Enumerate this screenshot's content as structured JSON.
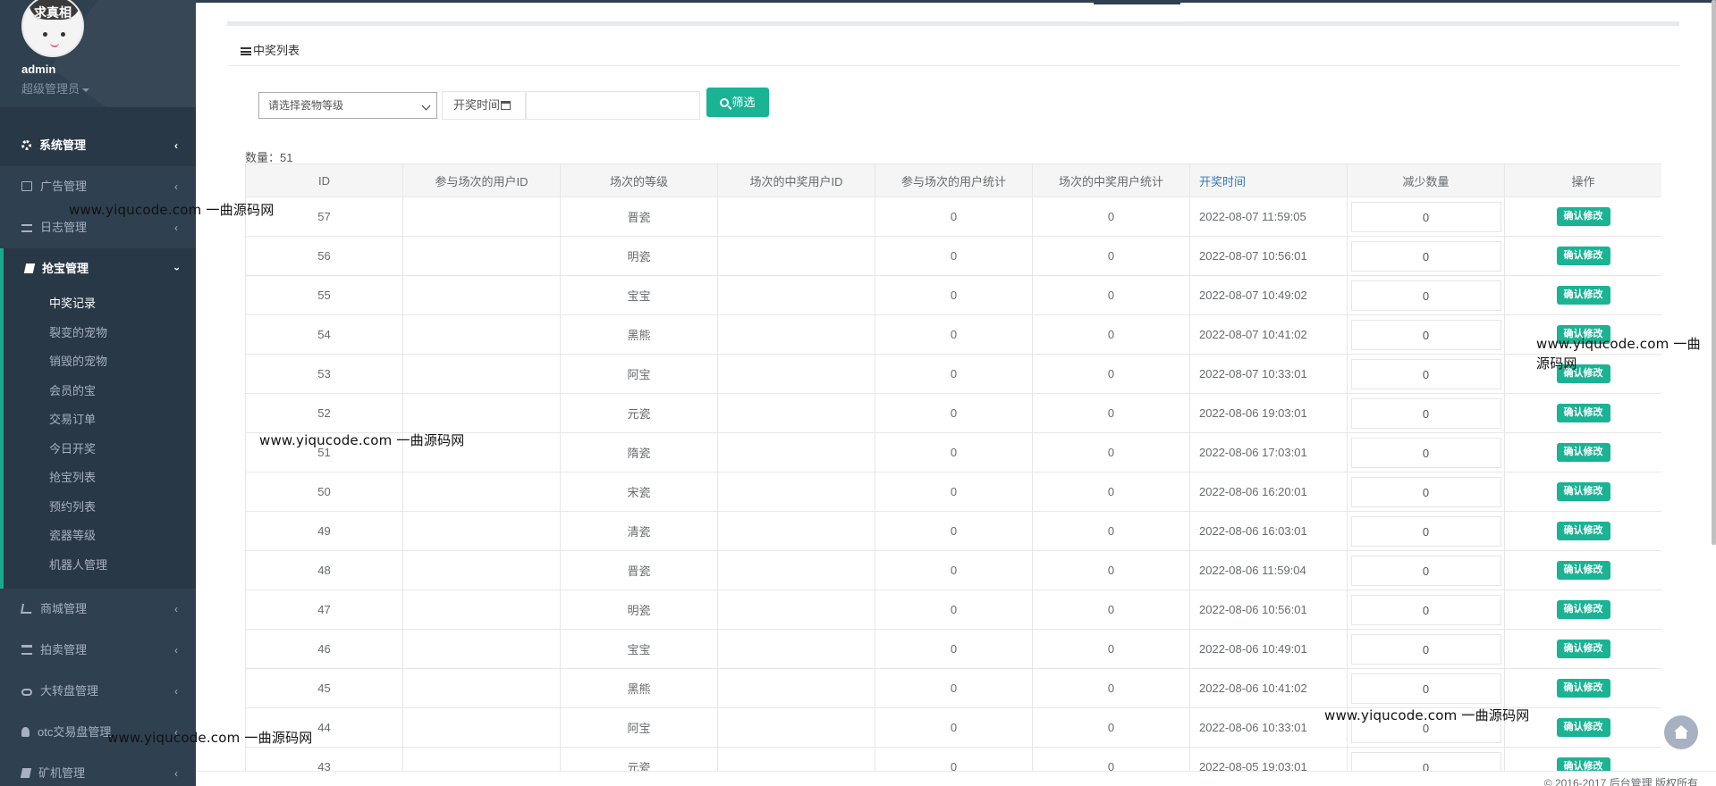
{
  "profile": {
    "avatar_text": "求真相",
    "username": "admin",
    "role": "超级管理员"
  },
  "menu": {
    "items_top": [
      {
        "label": "系统管理",
        "icon": "gear-icon"
      },
      {
        "label": "广告管理",
        "icon": "picture-icon"
      },
      {
        "label": "日志管理",
        "icon": "list-icon"
      }
    ],
    "active_group": {
      "label": "抢宝管理",
      "icon": "book-icon",
      "children": [
        "中奖记录",
        "裂变的宠物",
        "销毁的宠物",
        "会员的宝",
        "交易订单",
        "今日开奖",
        "抢宝列表",
        "预约列表",
        "瓷器等级",
        "机器人管理"
      ]
    },
    "items_bottom": [
      {
        "label": "商城管理",
        "icon": "cart-icon"
      },
      {
        "label": "拍卖管理",
        "icon": "bank-icon"
      },
      {
        "label": "大转盘管理",
        "icon": "gamepad-icon"
      },
      {
        "label": "otc交易盘管理",
        "icon": "user-icon"
      },
      {
        "label": "矿机管理",
        "icon": "book-icon"
      }
    ]
  },
  "panel": {
    "title": "中奖列表"
  },
  "filter": {
    "select_placeholder": "请选择瓷物等级",
    "date_label": "开奖时间",
    "date_value": "",
    "button_label": "筛选"
  },
  "count_text": "数量：51",
  "table": {
    "headers": [
      "ID",
      "参与场次的用户ID",
      "场次的等级",
      "场次的中奖用户ID",
      "参与场次的用户统计",
      "场次的中奖用户统计",
      "开奖时间",
      "减少数量",
      "操作"
    ],
    "action_label": "确认修改",
    "rows": [
      {
        "id": "57",
        "users": "",
        "level": "晋瓷",
        "winner": "",
        "user_count": "0",
        "win_count": "0",
        "time": "2022-08-07 11:59:05",
        "reduce": "0"
      },
      {
        "id": "56",
        "users": "",
        "level": "明瓷",
        "winner": "",
        "user_count": "0",
        "win_count": "0",
        "time": "2022-08-07 10:56:01",
        "reduce": "0"
      },
      {
        "id": "55",
        "users": "",
        "level": "宝宝",
        "winner": "",
        "user_count": "0",
        "win_count": "0",
        "time": "2022-08-07 10:49:02",
        "reduce": "0"
      },
      {
        "id": "54",
        "users": "",
        "level": "黑熊",
        "winner": "",
        "user_count": "0",
        "win_count": "0",
        "time": "2022-08-07 10:41:02",
        "reduce": "0"
      },
      {
        "id": "53",
        "users": "",
        "level": "阿宝",
        "winner": "",
        "user_count": "0",
        "win_count": "0",
        "time": "2022-08-07 10:33:01",
        "reduce": "0"
      },
      {
        "id": "52",
        "users": "",
        "level": "元瓷",
        "winner": "",
        "user_count": "0",
        "win_count": "0",
        "time": "2022-08-06 19:03:01",
        "reduce": "0"
      },
      {
        "id": "51",
        "users": "",
        "level": "隋瓷",
        "winner": "",
        "user_count": "0",
        "win_count": "0",
        "time": "2022-08-06 17:03:01",
        "reduce": "0"
      },
      {
        "id": "50",
        "users": "",
        "level": "宋瓷",
        "winner": "",
        "user_count": "0",
        "win_count": "0",
        "time": "2022-08-06 16:20:01",
        "reduce": "0"
      },
      {
        "id": "49",
        "users": "",
        "level": "清瓷",
        "winner": "",
        "user_count": "0",
        "win_count": "0",
        "time": "2022-08-06 16:03:01",
        "reduce": "0"
      },
      {
        "id": "48",
        "users": "",
        "level": "晋瓷",
        "winner": "",
        "user_count": "0",
        "win_count": "0",
        "time": "2022-08-06 11:59:04",
        "reduce": "0"
      },
      {
        "id": "47",
        "users": "",
        "level": "明瓷",
        "winner": "",
        "user_count": "0",
        "win_count": "0",
        "time": "2022-08-06 10:56:01",
        "reduce": "0"
      },
      {
        "id": "46",
        "users": "",
        "level": "宝宝",
        "winner": "",
        "user_count": "0",
        "win_count": "0",
        "time": "2022-08-06 10:49:01",
        "reduce": "0"
      },
      {
        "id": "45",
        "users": "",
        "level": "黑熊",
        "winner": "",
        "user_count": "0",
        "win_count": "0",
        "time": "2022-08-06 10:41:02",
        "reduce": "0"
      },
      {
        "id": "44",
        "users": "",
        "level": "阿宝",
        "winner": "",
        "user_count": "0",
        "win_count": "0",
        "time": "2022-08-06 10:33:01",
        "reduce": "0"
      },
      {
        "id": "43",
        "users": "",
        "level": "元瓷",
        "winner": "",
        "user_count": "0",
        "win_count": "0",
        "time": "2022-08-05 19:03:01",
        "reduce": "0"
      }
    ]
  },
  "watermarks": [
    "www.yiqucode.com  一曲源码网",
    "www.yiqucode.com  一曲源码网",
    "www.yiqucode.com  一曲源码网",
    "www.yiqucode.com  一曲源码网",
    "www.yiqucode.com  一曲源码网"
  ],
  "footer": {
    "text": "© 2016-2017    后台管理  版权所有"
  },
  "colors": {
    "sidebar_bg": "#2f4050",
    "sidebar_active_bg": "#293846",
    "accent": "#1ab394",
    "link": "#337ab7"
  }
}
